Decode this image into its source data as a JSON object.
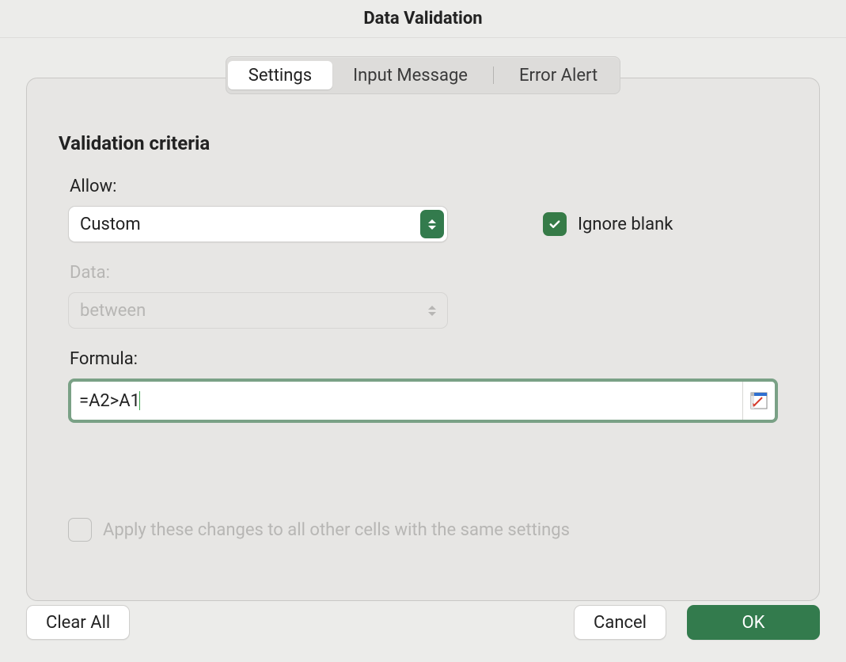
{
  "dialog": {
    "title": "Data Validation",
    "tabs": [
      {
        "label": "Settings",
        "active": true
      },
      {
        "label": "Input Message",
        "active": false
      },
      {
        "label": "Error Alert",
        "active": false
      }
    ],
    "section_title": "Validation criteria",
    "allow": {
      "label": "Allow:",
      "value": "Custom"
    },
    "ignore_blank": {
      "label": "Ignore blank",
      "checked": true
    },
    "data": {
      "label": "Data:",
      "value": "between",
      "enabled": false
    },
    "formula": {
      "label": "Formula:",
      "value": "=A2>A1"
    },
    "apply_all": {
      "label": "Apply these changes to all other cells with the same settings",
      "checked": false,
      "enabled": false
    },
    "buttons": {
      "clear_all": "Clear All",
      "cancel": "Cancel",
      "ok": "OK"
    }
  }
}
